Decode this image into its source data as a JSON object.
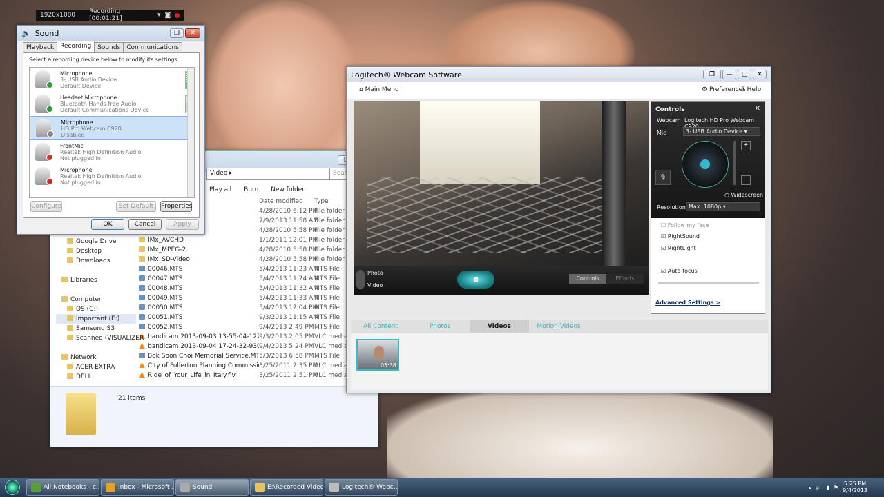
{
  "recorder": {
    "resolution": "1920x1080",
    "status": "Recording [00:01:21]"
  },
  "sound": {
    "title": "Sound",
    "tabs": [
      "Playback",
      "Recording",
      "Sounds",
      "Communications"
    ],
    "instruction": "Select a recording device below to modify its settings:",
    "devices": [
      {
        "name": "Microphone",
        "desc": "3- USB Audio Device",
        "status": "Default Device"
      },
      {
        "name": "Headset Microphone",
        "desc": "Bluetooth Hands-free Audio",
        "status": "Default Communications Device"
      },
      {
        "name": "Microphone",
        "desc": "HD Pro Webcam C920",
        "status": "Disabled"
      },
      {
        "name": "FrontMic",
        "desc": "Realtek High Definition Audio",
        "status": "Not plugged in"
      },
      {
        "name": "Microphone",
        "desc": "Realtek High Definition Audio",
        "status": "Not plugged in"
      }
    ],
    "configure": "Configure",
    "set_default": "Set Default",
    "properties": "Properties",
    "ok": "OK",
    "cancel": "Cancel",
    "apply": "Apply"
  },
  "explorer": {
    "address": "Video",
    "search_placeholder": "Search",
    "toolbar": {
      "play_all": "Play all",
      "burn": "Burn",
      "new_folder": "New folder"
    },
    "columns": {
      "date": "Date modified",
      "type": "Type"
    },
    "nav": [
      "Google Drive",
      "Desktop",
      "Downloads",
      "",
      "Libraries",
      "",
      "Computer",
      "OS (C:)",
      "Important (E:)",
      "Samsung S3",
      "Scanned (VISUALIZER-",
      "",
      "Network",
      "ACER-EXTRA",
      "DELL"
    ],
    "files": [
      {
        "name": "",
        "date": "4/28/2010 6:12 PM",
        "type": "File folder",
        "kind": "folder"
      },
      {
        "name": "",
        "date": "7/9/2013 11:58 AM",
        "type": "File folder",
        "kind": "folder"
      },
      {
        "name": "ssignments",
        "date": "4/28/2010 5:58 PM",
        "type": "File folder",
        "kind": "folder"
      },
      {
        "name": "IMx_AVCHD",
        "date": "1/1/2011 12:01 PM",
        "type": "File folder",
        "kind": "folder"
      },
      {
        "name": "IMx_MPEG-2",
        "date": "4/28/2010 5:58 PM",
        "type": "File folder",
        "kind": "folder"
      },
      {
        "name": "IMx_SD-Video",
        "date": "4/28/2010 5:58 PM",
        "type": "File folder",
        "kind": "folder"
      },
      {
        "name": "00046.MTS",
        "date": "5/4/2013 11:23 AM",
        "type": "MTS File",
        "kind": "mts"
      },
      {
        "name": "00047.MTS",
        "date": "5/4/2013 11:24 AM",
        "type": "MTS File",
        "kind": "mts"
      },
      {
        "name": "00048.MTS",
        "date": "5/4/2013 11:32 AM",
        "type": "MTS File",
        "kind": "mts"
      },
      {
        "name": "00049.MTS",
        "date": "5/4/2013 11:33 AM",
        "type": "MTS File",
        "kind": "mts"
      },
      {
        "name": "00050.MTS",
        "date": "5/4/2013 12:04 PM",
        "type": "MTS File",
        "kind": "mts"
      },
      {
        "name": "00051.MTS",
        "date": "9/3/2013 11:15 AM",
        "type": "MTS File",
        "kind": "mts"
      },
      {
        "name": "00052.MTS",
        "date": "9/4/2013 2:49 PM",
        "type": "MTS File",
        "kind": "mts"
      },
      {
        "name": "bandicam 2013-09-03 13-55-04-127.avi",
        "date": "9/3/2013 2:05 PM",
        "type": "VLC media fi",
        "kind": "vlc"
      },
      {
        "name": "bandicam 2013-09-04 17-24-32-930.avi",
        "date": "9/4/2013 5:24 PM",
        "type": "VLC media fi",
        "kind": "vlc"
      },
      {
        "name": "Bok Soon Choi Memorial Service.MTS",
        "date": "5/3/2013 6:58 PM",
        "type": "MTS File",
        "kind": "mts"
      },
      {
        "name": "City of Fullerton Planning Commission C...",
        "date": "3/25/2011 2:35 PM",
        "type": "VLC media fi",
        "kind": "vlc"
      },
      {
        "name": "Ride_of_Your_Life_in_Italy.flv",
        "date": "3/25/2011 2:51 PM",
        "type": "VLC media fi",
        "kind": "vlc"
      }
    ],
    "item_count": "21 items"
  },
  "logitech": {
    "title": "Logitech® Webcam Software",
    "main_menu": "Main Menu",
    "preferences": "Preferences",
    "help": "Help",
    "photo": "Photo",
    "video": "Video",
    "controls_btn": "Controls",
    "effects_btn": "Effects",
    "controls": {
      "title": "Controls",
      "webcam_label": "Webcam",
      "webcam_value": "Logitech HD Pro Webcam C920",
      "mic_label": "Mic",
      "mic_value": "3- USB Audio Device",
      "widescreen": "Widescreen",
      "resolution_label": "Resolution",
      "resolution_value": "Max: 1080p",
      "follow": "Follow my face",
      "rightsound": "RightSound",
      "rightlight": "RightLight",
      "autofocus": "Auto-focus",
      "advanced": "Advanced Settings >"
    },
    "tabs": [
      "All Content",
      "Photos",
      "Videos",
      "Motion Videos"
    ],
    "thumb_duration": "05:38"
  },
  "taskbar": {
    "items": [
      "All Notebooks - c...",
      "Inbox - Microsoft ...",
      "Sound",
      "E:\\Recorded Video",
      "Logitech® Webc..."
    ],
    "time": "5:25 PM",
    "date": "9/4/2013"
  }
}
